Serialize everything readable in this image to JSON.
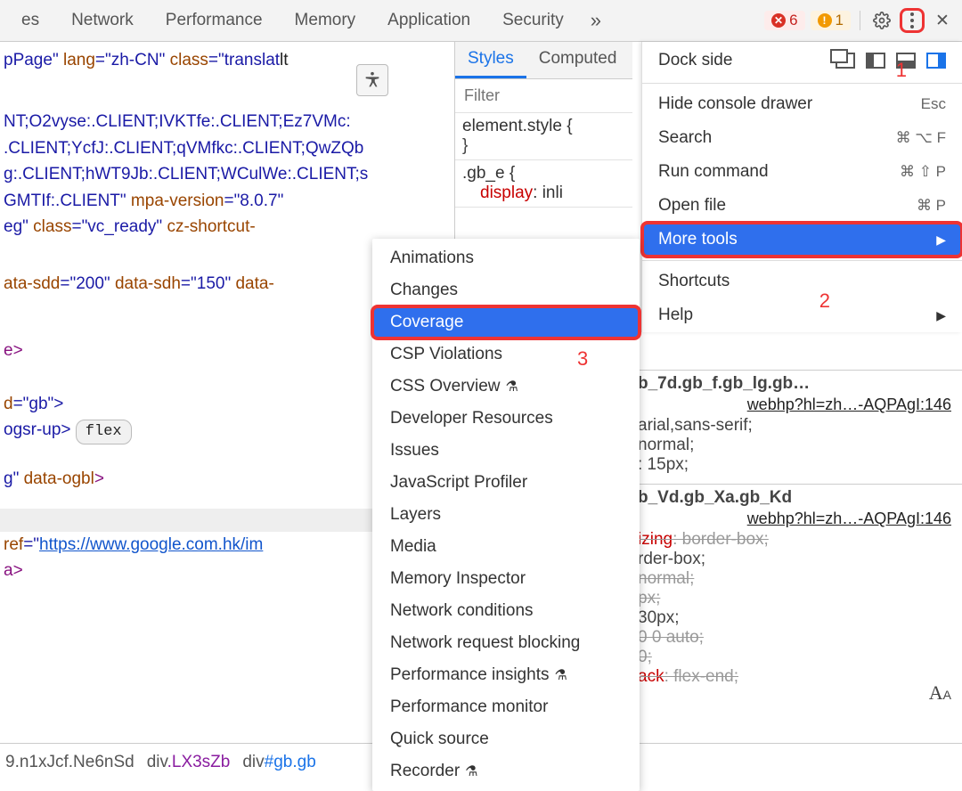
{
  "tabs": [
    "es",
    "Network",
    "Performance",
    "Memory",
    "Application",
    "Security"
  ],
  "badges": {
    "errors": "6",
    "warnings": "1"
  },
  "elements": {
    "l1a": "pPage\" ",
    "l1_lang_attr": "lang",
    "l1_lang_val": "=\"zh-CN\" ",
    "l1_class_attr": "class",
    "l1_class_val": "=\"translat",
    "l1_tail": "lt",
    "block1": "NT;O2vyse:.CLIENT;IVKTfe:.CLIENT;Ez7VMc:\n.CLIENT;YcfJ:.CLIENT;qVMfkc:.CLIENT;QwZQb\ng:.CLIENT;hWT9Jb:.CLIENT;WCulWe:.CLIENT;s\nGMTIf:.CLIENT\" ",
    "mpa_attr": "mpa-version",
    "mpa_val": "=\"8.0.7\"",
    "l5_pre": "eg\" ",
    "l5_class_attr": "class",
    "l5_class_val": "=\"vc_ready\" ",
    "l5_tail": "cz-shortcut-",
    "l_sdd_attr": "ata-sdd",
    "l_sdd_val": "=\"200\" ",
    "l_sdh_attr": "data-sdh",
    "l_sdh_val": "=\"150\" ",
    "l_sdh_tail": "data-",
    "e_close": "e>",
    "gb_attr": "d",
    "gb_val": "=\"gb\">",
    "ogsr": "ogsr-up> ",
    "flex_pill": "flex",
    "ogbl_pre": "g\" ",
    "ogbl_attr": "data-ogbl",
    "ogbl_tail": ">",
    "href_attr": "ref",
    "href_val": "=\"",
    "href_link": "https://www.google.com.hk/im",
    "a_close": "a>"
  },
  "styles": {
    "tab1": "Styles",
    "tab2": "Computed",
    "filter_ph": "Filter",
    "sel1": "element.style {",
    "sel1_close": "}",
    "sel2": ".gb_e {",
    "prop2": "display",
    "val2": ": inli"
  },
  "detail": {
    "sel1": "b_7d.gb_f.gb_lg.gb…",
    "file": "webhp?hl=zh…-AQPAgI:146",
    "b1l1": "arial,sans-serif;",
    "b1l2": "normal;",
    "b1l3": ": 15px;",
    "sel2": "b_Vd.gb_Xa.gb_Kd",
    "b2l1_prop": "izing",
    "b2l1_val": ": border-box;",
    "b2l2": "rder-box;",
    "b2l3": "normal;",
    "b2l4": "px;",
    "b2l5": " 30px;",
    "b2l6": "0 0 auto;",
    "b2l7": " 0;",
    "b2l8_prop": "ack",
    "b2l8_val": ": flex-end;"
  },
  "menu": {
    "dock": "Dock side",
    "hide": "Hide console drawer",
    "hide_sc": "Esc",
    "search": "Search",
    "search_sc": "⌘ ⌥ F",
    "run": "Run command",
    "run_sc": "⌘ ⇧ P",
    "open": "Open file",
    "open_sc": "⌘ P",
    "more": "More tools",
    "shortcuts": "Shortcuts",
    "help": "Help"
  },
  "submenu": [
    "Animations",
    "Changes",
    "Coverage",
    "CSP Violations",
    "CSS Overview",
    "Developer Resources",
    "Issues",
    "JavaScript Profiler",
    "Layers",
    "Media",
    "Memory Inspector",
    "Network conditions",
    "Network request blocking",
    "Performance insights",
    "Performance monitor",
    "Quick source",
    "Recorder"
  ],
  "crumb": {
    "c1_pre": "9.n1xJcf.Ne6nSd",
    "c2": "div",
    "c2_cls": ".LX3sZb",
    "c3": "div",
    "c3_id": "#gb.gb"
  },
  "anno": {
    "one": "1",
    "two": "2",
    "three": "3"
  }
}
